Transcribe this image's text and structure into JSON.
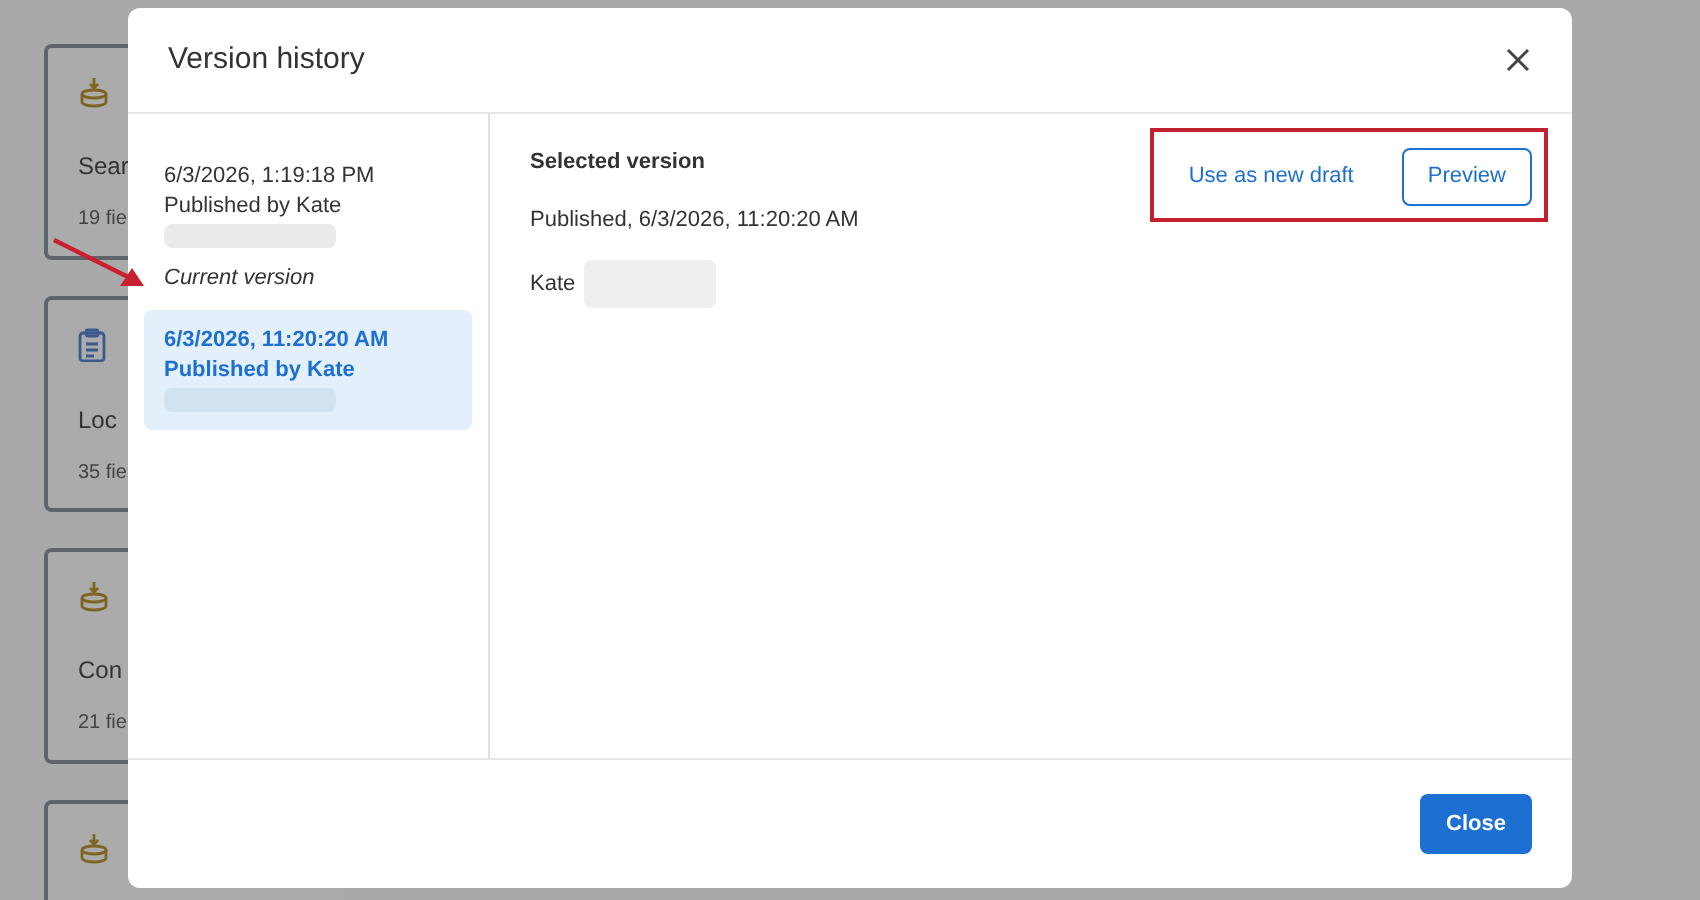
{
  "background_cards": [
    {
      "kind": "database",
      "title": "Sear",
      "meta": "19 fie"
    },
    {
      "kind": "clipboard",
      "title": "Loc",
      "meta": "35 fie"
    },
    {
      "kind": "database",
      "title": "Con",
      "meta": "21 fie"
    },
    {
      "kind": "database"
    }
  ],
  "dialog": {
    "title": "Version history",
    "versions": [
      {
        "date": "6/3/2026, 1:19:18 PM",
        "author": "Published by Kate",
        "note": "Current version",
        "selected": false
      },
      {
        "date": "6/3/2026, 11:20:20 AM",
        "author": "Published by Kate",
        "selected": true
      }
    ],
    "selected_version": {
      "heading": "Selected version",
      "published": "Published, 6/3/2026, 11:20:20 AM",
      "author": "Kate"
    },
    "actions": [
      {
        "label": "Use as new draft",
        "kind": "link"
      },
      {
        "label": "Preview",
        "kind": "outlined"
      }
    ],
    "footer_button": "Close"
  }
}
